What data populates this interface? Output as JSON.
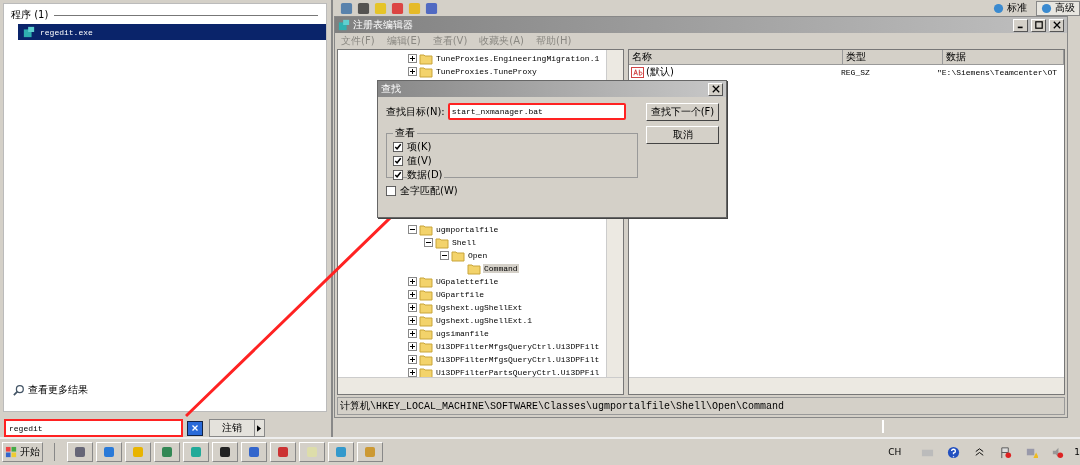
{
  "start_menu": {
    "section_header": "程序 (1)",
    "results": [
      {
        "label": "regedit.exe",
        "selected": true
      }
    ],
    "more_results": "查看更多结果",
    "search": {
      "value": "regedit"
    },
    "logoff_button": "注销"
  },
  "background_toolbar": {
    "view_buttons": [
      {
        "label": "标准",
        "selected": false
      },
      {
        "label": "高级",
        "selected": true
      }
    ]
  },
  "registry_editor": {
    "title": "注册表编辑器",
    "menu": [
      {
        "label": "文件(F)",
        "disabled": true
      },
      {
        "label": "编辑(E)",
        "disabled": true
      },
      {
        "label": "查看(V)",
        "disabled": true
      },
      {
        "label": "收藏夹(A)",
        "disabled": true
      },
      {
        "label": "帮助(H)",
        "disabled": true
      }
    ],
    "tree_above_dialog": [
      {
        "label": "TuneProxies.EngineeringMigration.1",
        "expanded": false,
        "selected": false
      },
      {
        "label": "TuneProxies.TuneProxy",
        "expanded": false,
        "selected": false
      }
    ],
    "tree_below_dialog": [
      {
        "label": "ugmportalfile",
        "expanded": true,
        "selected": false,
        "children": [
          {
            "label": "Shell",
            "expanded": true,
            "selected": false,
            "children": [
              {
                "label": "Open",
                "expanded": true,
                "selected": false,
                "children": [
                  {
                    "label": "Command",
                    "selected": true
                  }
                ]
              }
            ]
          }
        ]
      },
      {
        "label": "UGpalettefile",
        "expanded": false,
        "selected": false
      },
      {
        "label": "UGpartfile",
        "expanded": false,
        "selected": false
      },
      {
        "label": "Ugshext.ugShellExt",
        "expanded": false,
        "selected": false
      },
      {
        "label": "Ugshext.ugShellExt.1",
        "expanded": false,
        "selected": false
      },
      {
        "label": "ugsimanfile",
        "expanded": false,
        "selected": false
      },
      {
        "label": "Ui3DPFilterMfgsQueryCtrl.Ui3DPFilt",
        "expanded": false,
        "selected": false
      },
      {
        "label": "Ui3DPFilterMfgsQueryCtrl.Ui3DPFilt",
        "expanded": false,
        "selected": false
      },
      {
        "label": "Ui3DPFilterPartsQueryCtrl.Ui3DPFil",
        "expanded": false,
        "selected": false
      }
    ],
    "list": {
      "columns": [
        "名称",
        "类型",
        "数据"
      ],
      "rows": [
        {
          "name": "(默认)",
          "type": "REG_SZ",
          "data": "\"E:\\Siemens\\Teamcenter\\OT"
        }
      ]
    },
    "status_bar": "计算机\\HKEY_LOCAL_MACHINE\\SOFTWARE\\Classes\\ugmportalfile\\Shell\\Open\\Command"
  },
  "find_dialog": {
    "title": "查找",
    "target_label": "查找目标(N):",
    "target": {
      "value": "start_nxmanager.bat"
    },
    "find_next_button": "查找下一个(F)",
    "cancel_button": "取消",
    "look_at": {
      "title": "查看",
      "options": [
        {
          "label": "项(K)",
          "checked": true
        },
        {
          "label": "值(V)",
          "checked": true
        },
        {
          "label": "数据(D)",
          "checked": true
        }
      ]
    },
    "match_whole": {
      "label": "全字匹配(W)",
      "checked": false
    }
  },
  "taskbar": {
    "start_button": "开始",
    "language": "CH",
    "clock": "1"
  }
}
